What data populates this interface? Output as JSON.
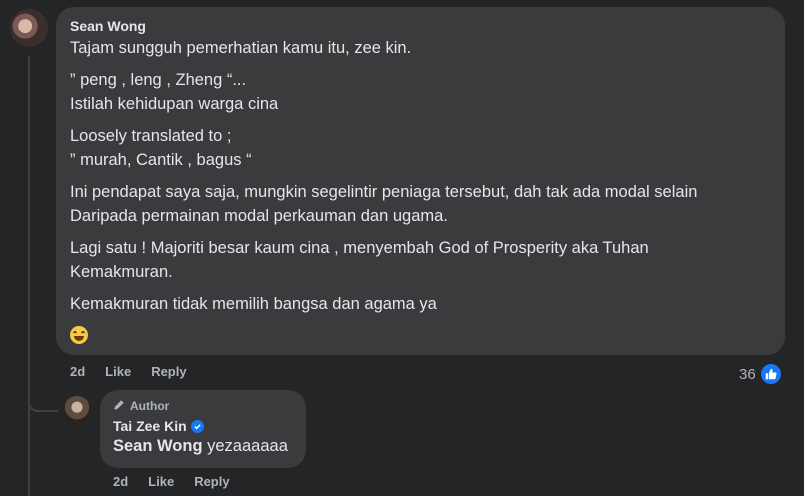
{
  "comment": {
    "author": "Sean Wong",
    "paragraphs": [
      [
        "Tajam sungguh pemerhatian kamu itu, zee kin."
      ],
      [
        "” peng , leng , Zheng “...",
        "Istilah kehidupan warga cina"
      ],
      [
        "Loosely translated to ;",
        "” murah, Cantik , bagus “"
      ],
      [
        "Ini pendapat saya saja, mungkin segelintir peniaga tersebut, dah tak ada modal selain",
        "Daripada permainan modal perkauman dan ugama."
      ],
      [
        "Lagi satu ! Majoriti besar kaum cina , menyembah God of Prosperity aka Tuhan",
        "Kemakmuran."
      ],
      [
        "Kemakmuran tidak memilih bangsa dan agama ya"
      ]
    ],
    "emoji": "grinning-squinting-face",
    "time": "2d",
    "like_label": "Like",
    "reply_label": "Reply",
    "reaction_count": "36",
    "reaction_icon": "thumbs-up-icon"
  },
  "reply": {
    "badge_label": "Author",
    "badge_icon": "pencil-icon",
    "author": "Tai Zee Kin",
    "verified": true,
    "mention": "Sean Wong",
    "text": " yezaaaaaa",
    "time": "2d",
    "like_label": "Like",
    "reply_label": "Reply"
  },
  "colors": {
    "background": "#242526",
    "bubble": "#3a3b3c",
    "text": "#e4e6eb",
    "secondary_text": "#b0b3b8",
    "accent": "#1877f2"
  }
}
